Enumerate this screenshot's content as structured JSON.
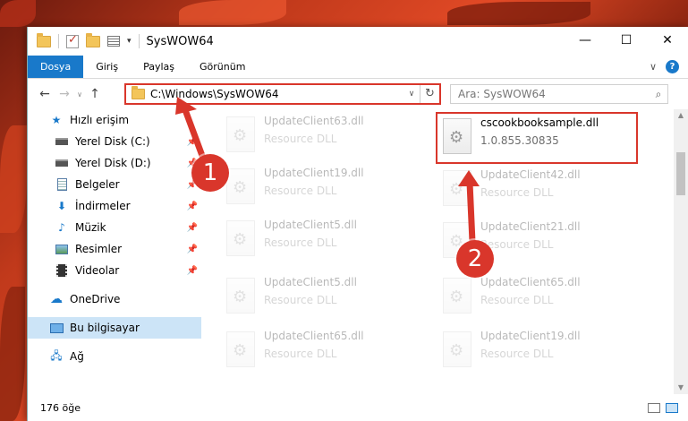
{
  "window": {
    "title": "SysWOW64",
    "controls": {
      "minimize": "—",
      "maximize": "☐",
      "close": "✕"
    }
  },
  "ribbon": {
    "tabs": [
      "Dosya",
      "Giriş",
      "Paylaş",
      "Görünüm"
    ],
    "help": "?"
  },
  "address": {
    "path": "C:\\Windows\\SysWOW64",
    "search_placeholder": "Ara: SysWOW64"
  },
  "nav": {
    "items": [
      {
        "label": "Hızlı erişim",
        "icon": "star-icon",
        "pinned": false
      },
      {
        "label": "Yerel Disk (C:)",
        "icon": "drive-icon",
        "pinned": true
      },
      {
        "label": "Yerel Disk (D:)",
        "icon": "drive-icon",
        "pinned": true
      },
      {
        "label": "Belgeler",
        "icon": "documents-icon",
        "pinned": true
      },
      {
        "label": "İndirmeler",
        "icon": "download-icon",
        "pinned": true
      },
      {
        "label": "Müzik",
        "icon": "music-icon",
        "pinned": true
      },
      {
        "label": "Resimler",
        "icon": "pictures-icon",
        "pinned": true
      },
      {
        "label": "Videolar",
        "icon": "video-icon",
        "pinned": true
      },
      {
        "label": "OneDrive",
        "icon": "cloud-icon",
        "pinned": false
      },
      {
        "label": "Bu bilgisayar",
        "icon": "computer-icon",
        "pinned": false
      },
      {
        "label": "Ağ",
        "icon": "network-icon",
        "pinned": false
      }
    ]
  },
  "files": {
    "highlighted": {
      "name": "cscookbooksample.dll",
      "detail": "1.0.855.30835"
    },
    "items": [
      {
        "name": "UpdateClient63.dll",
        "detail": "Resource DLL"
      },
      {
        "name": "UpdateClient19.dll",
        "detail": "Resource DLL"
      },
      {
        "name": "UpdateClient42.dll",
        "detail": "Resource DLL"
      },
      {
        "name": "UpdateClient5.dll",
        "detail": "Resource DLL"
      },
      {
        "name": "UpdateClient21.dll",
        "detail": "Resource DLL"
      },
      {
        "name": "UpdateClient5.dll",
        "detail": "Resource DLL"
      },
      {
        "name": "UpdateClient65.dll",
        "detail": "Resource DLL"
      },
      {
        "name": "UpdateClient65.dll",
        "detail": "Resource DLL"
      },
      {
        "name": "UpdateClient19.dll",
        "detail": "Resource DLL"
      }
    ]
  },
  "status": {
    "count": "176 öğe"
  },
  "annotations": {
    "step1": "1",
    "step2": "2",
    "color": "#d9362b"
  }
}
